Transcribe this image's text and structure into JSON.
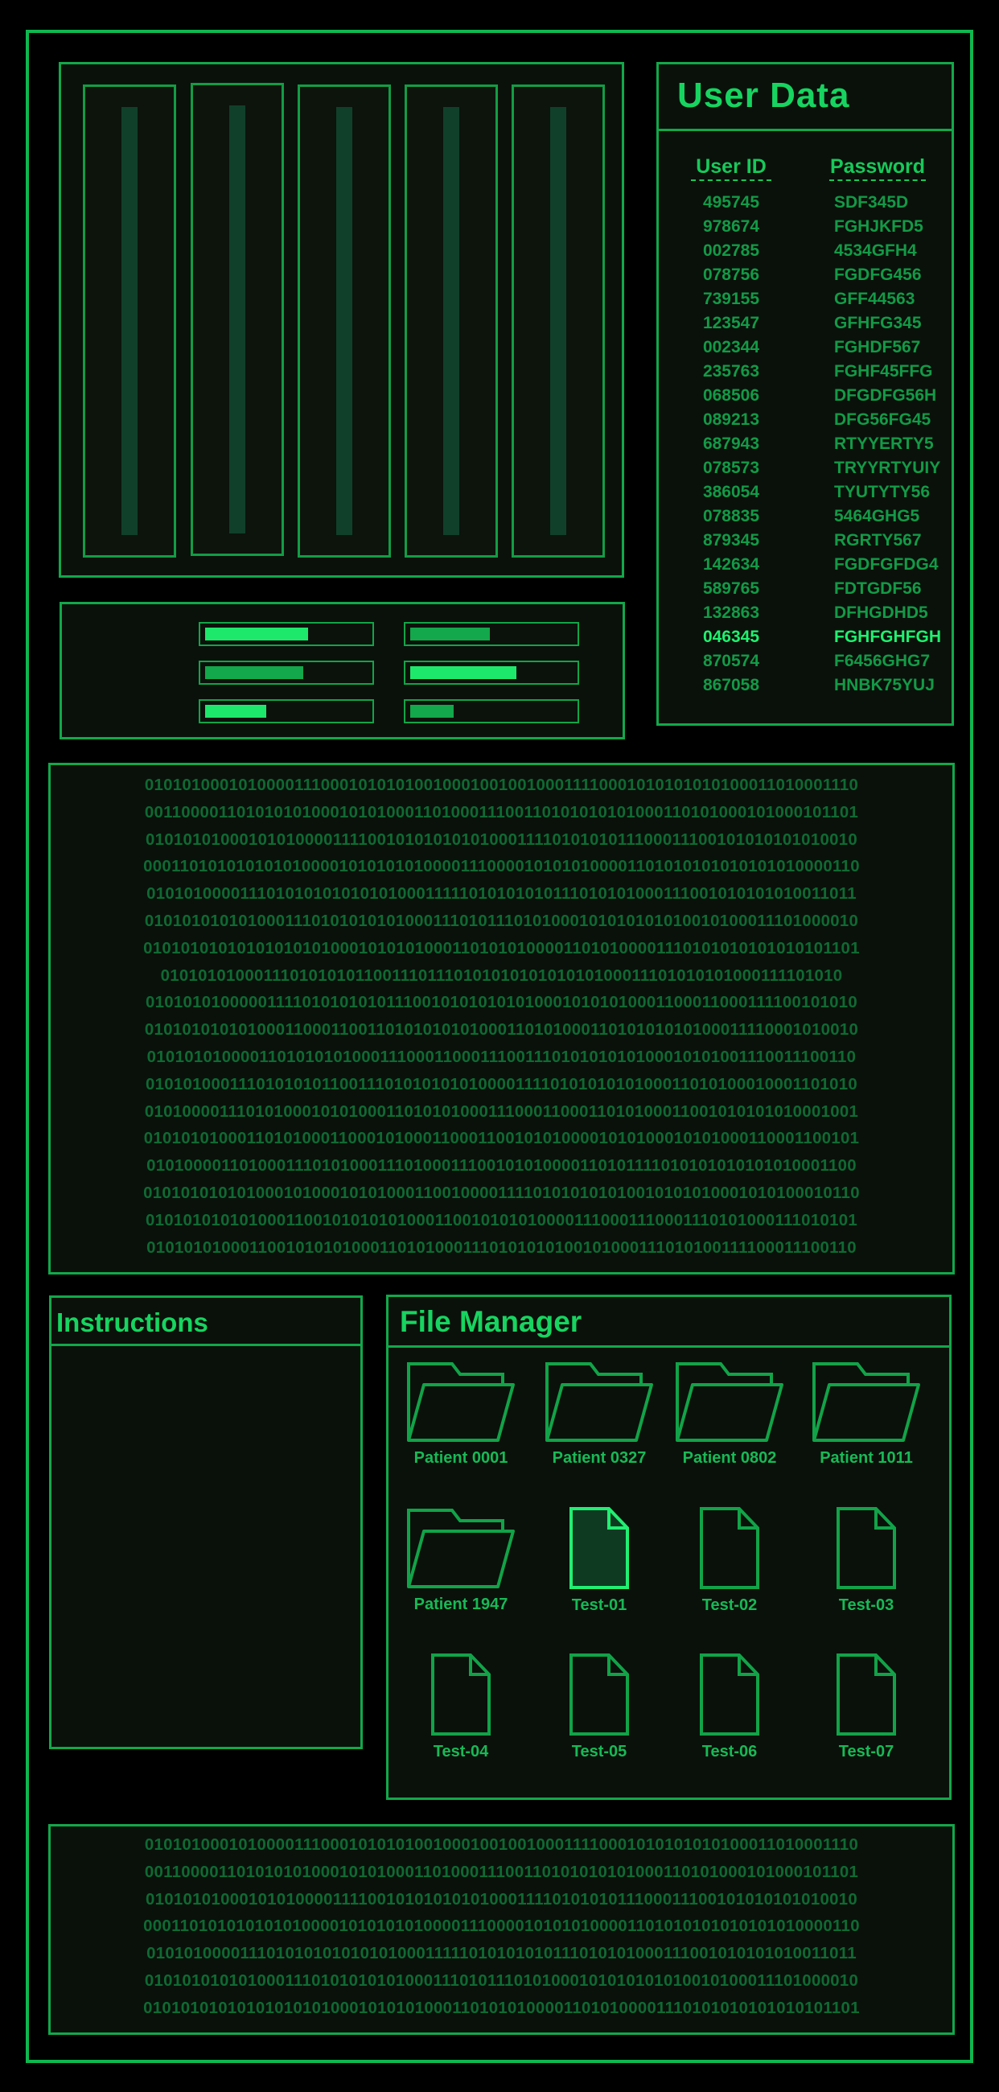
{
  "user_data": {
    "title": "User Data",
    "col_id": "User ID",
    "col_password": "Password",
    "rows": [
      {
        "id": "495745",
        "pw": "SDF345D"
      },
      {
        "id": "978674",
        "pw": "FGHJKFD5"
      },
      {
        "id": "002785",
        "pw": "4534GFH4"
      },
      {
        "id": "078756",
        "pw": "FGDFG456"
      },
      {
        "id": "739155",
        "pw": "GFF44563"
      },
      {
        "id": "123547",
        "pw": "GFHFG345"
      },
      {
        "id": "002344",
        "pw": "FGHDF567"
      },
      {
        "id": "235763",
        "pw": "FGHF45FFG"
      },
      {
        "id": "068506",
        "pw": "DFGDFG56H"
      },
      {
        "id": "089213",
        "pw": "DFG56FG45"
      },
      {
        "id": "687943",
        "pw": "RTYYERTY5"
      },
      {
        "id": "078573",
        "pw": "TRYYRTYUIY"
      },
      {
        "id": "386054",
        "pw": "TYUTYTY56"
      },
      {
        "id": "078835",
        "pw": "5464GHG5"
      },
      {
        "id": "879345",
        "pw": "RGRTY567"
      },
      {
        "id": "142634",
        "pw": "FGDFGFDG4"
      },
      {
        "id": "589765",
        "pw": "FDTGDF56"
      },
      {
        "id": "132863",
        "pw": "DFHGDHD5"
      },
      {
        "id": "046345",
        "pw": "FGHFGHFGH"
      },
      {
        "id": "870574",
        "pw": "F6456GHG7"
      },
      {
        "id": "867058",
        "pw": "HNBK75YUJ"
      }
    ],
    "highlight_index": 18
  },
  "levels": [
    {
      "value": 0.62,
      "color": "#1ee86b"
    },
    {
      "value": 0.48,
      "color": "#13a84b"
    },
    {
      "value": 0.59,
      "color": "#13a84b"
    },
    {
      "value": 0.64,
      "color": "#1ee86b"
    },
    {
      "value": 0.37,
      "color": "#1ee86b"
    },
    {
      "value": 0.26,
      "color": "#13a84b"
    }
  ],
  "binary_main": [
    "01010100010100001110001010101001000100100100011110001010101010100011010001110",
    "00110000110101010100010101000110100011100110101010101000110101000101000101101",
    "01010101000101010000111100101010101010001111010101011100011100101010101010010",
    "00011010101010101000010101010100001110000101010100001101010101010101010000110",
    "01010100001110101010101010100011111010101010111010101000111001010101010011011",
    "01010101010100011101010101010001110101110101000101010101010010100011101000010",
    "01010101010101010101000101010100011010101000011010100001110101010101010101101",
    "01010101000111010101011001110111010101010101010100011101010101000111101010",
    "01010101000001111010101010111001010101010100010101010001100011000111100101010",
    "01010101010100011000110011010101010100011010100011010101010100011110001010010",
    "01010101000011010101010001110001100011100111010101010100010101001110011100110",
    "01010100011101010101100111010101010100001111010101010100011010100010001101010",
    "01010000111010100010101000110101010001110001100011010100011001010101010001001",
    "01010101000110101000110001010001100011001010100001010100010101000110001100101",
    "01010000110100011101010001110100011100101010000110101111010101010101010001100",
    "01010101010100010100010101000110010000111101010101010010101010001010100010110",
    "01010101010100011001010101010001100101010100001110001110001110101000111010101",
    "01010101000110010101010001101010001110101010100101000111010100111100011100110"
  ],
  "binary_bottom": [
    "01010100010100001110001010101001000100100100011110001010101010100011010001110",
    "00110000110101010100010101000110100011100110101010101000110101000101000101101",
    "01010101000101010000111100101010101010001111010101011100011100101010101010010",
    "00011010101010101000010101010100001110000101010100001101010101010101010000110",
    "01010100001110101010101010100011111010101010111010101000111001010101010011011",
    "01010101010100011101010101010001110101110101000101010101010010100011101000010",
    "01010101010101010101000101010100011010101000011010100001110101010101010101101"
  ],
  "instructions": {
    "title": "Instructions"
  },
  "file_manager": {
    "title": "File Manager",
    "items": [
      {
        "label": "Patient 0001",
        "type": "folder"
      },
      {
        "label": "Patient 0327",
        "type": "folder"
      },
      {
        "label": "Patient 0802",
        "type": "folder"
      },
      {
        "label": "Patient 1011",
        "type": "folder"
      },
      {
        "label": "Patient 1947",
        "type": "folder"
      },
      {
        "label": "Test-01",
        "type": "file",
        "selected": true
      },
      {
        "label": "Test-02",
        "type": "file"
      },
      {
        "label": "Test-03",
        "type": "file"
      },
      {
        "label": "Test-04",
        "type": "file"
      },
      {
        "label": "Test-05",
        "type": "file"
      },
      {
        "label": "Test-06",
        "type": "file"
      },
      {
        "label": "Test-07",
        "type": "file"
      }
    ]
  },
  "colors": {
    "accent": "#17d460",
    "border": "#12a84a",
    "panel_bg": "#0a110a",
    "binary": "#0f6a33",
    "highlight": "#1ff06f"
  }
}
